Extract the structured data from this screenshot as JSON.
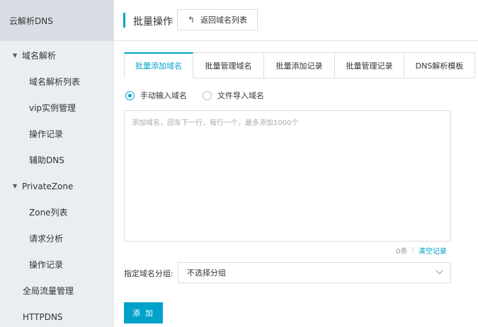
{
  "sidebar": {
    "title": "云解析DNS",
    "groups": [
      {
        "label": "域名解析",
        "caret": "▼"
      },
      {
        "label": "PrivateZone",
        "caret": "▼"
      }
    ],
    "items": {
      "domain_list": "域名解析列表",
      "vip": "vip实例管理",
      "op_log": "操作记录",
      "aux_dns": "辅助DNS",
      "zone_list": "Zone列表",
      "req_analysis": "请求分析",
      "pz_op_log": "操作记录",
      "global_traffic": "全局流量管理",
      "httpdns": "HTTPDNS"
    }
  },
  "header": {
    "title": "批量操作",
    "back_label": "返回域名列表",
    "back_icon": "↰"
  },
  "tabs": [
    {
      "label": "批量添加域名",
      "active": true
    },
    {
      "label": "批量管理域名",
      "active": false
    },
    {
      "label": "批量添加记录",
      "active": false
    },
    {
      "label": "批量管理记录",
      "active": false
    },
    {
      "label": "DNS解析模板",
      "active": false
    }
  ],
  "radios": {
    "manual": "手动输入域名",
    "file": "文件导入域名"
  },
  "textarea": {
    "placeholder": "添加域名，回车下一行，每行一个，最多添加1000个",
    "value": ""
  },
  "counter": {
    "count": "0条",
    "sep": "|",
    "clear": "清空记录"
  },
  "group": {
    "label": "指定域名分组:",
    "value": "不选择分组"
  },
  "add_button": "添 加",
  "colors": {
    "accent": "#00a2ca",
    "sidebar_bg": "#eaedf1",
    "sidebar_header_bg": "#d9dee4"
  }
}
